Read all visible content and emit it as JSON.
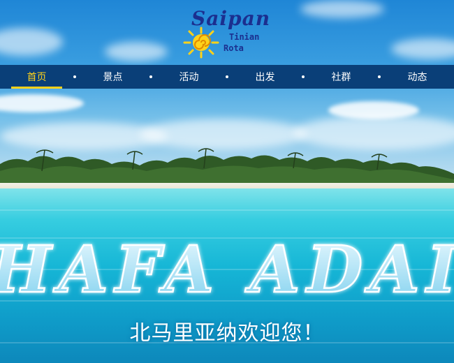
{
  "logo": {
    "main": "Saipan",
    "sub1": "Tinian",
    "sub2": "Rota"
  },
  "nav": {
    "items": [
      {
        "label": "首页",
        "active": true
      },
      {
        "label": "景点",
        "active": false
      },
      {
        "label": "活动",
        "active": false
      },
      {
        "label": "出发",
        "active": false
      },
      {
        "label": "社群",
        "active": false
      },
      {
        "label": "动态",
        "active": false
      }
    ]
  },
  "hero": {
    "headline": "HAFA ADAI",
    "welcome": "北马里亚纳欢迎您！"
  },
  "colors": {
    "nav_bg": "#0a3f78",
    "nav_active": "#ffd21a",
    "logo_text": "#1b2f8f",
    "sun": "#ffd21a"
  },
  "icons": [
    "sun-spiral-icon"
  ]
}
